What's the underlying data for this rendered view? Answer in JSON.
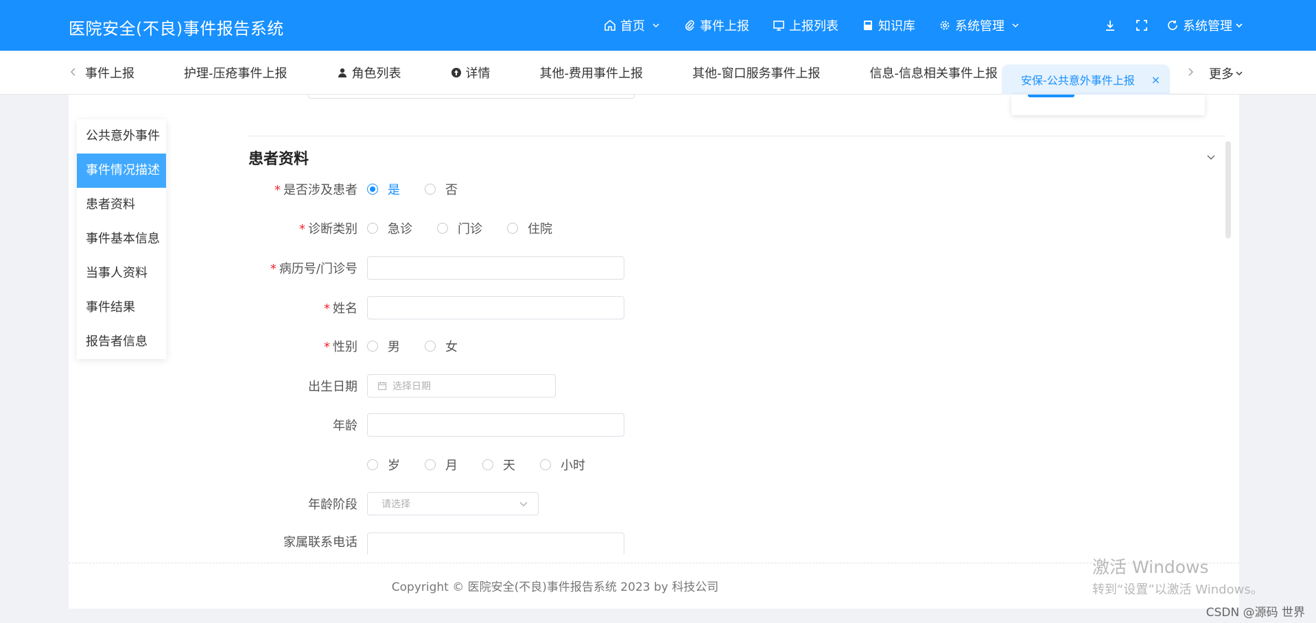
{
  "app": {
    "title": "医院安全(不良)事件报告系统"
  },
  "nav": {
    "items": [
      {
        "label": "首页",
        "icon": "home-icon",
        "dropdown": true
      },
      {
        "label": "事件上报",
        "icon": "paperclip-icon",
        "dropdown": false
      },
      {
        "label": "上报列表",
        "icon": "monitor-icon",
        "dropdown": false
      },
      {
        "label": "知识库",
        "icon": "book-icon",
        "dropdown": false
      },
      {
        "label": "系统管理",
        "icon": "gear-icon",
        "dropdown": true
      }
    ],
    "user_label": "系统管理"
  },
  "tabs": {
    "items": [
      {
        "label": "事件上报",
        "icon": ""
      },
      {
        "label": "护理-压疮事件上报",
        "icon": ""
      },
      {
        "label": "角色列表",
        "icon": "user-icon"
      },
      {
        "label": "详情",
        "icon": "info-circle-icon"
      },
      {
        "label": "其他-费用事件上报",
        "icon": ""
      },
      {
        "label": "其他-窗口服务事件上报",
        "icon": ""
      },
      {
        "label": "信息-信息相关事件上报",
        "icon": ""
      }
    ],
    "active": {
      "label": "安保-公共意外事件上报",
      "close": "×"
    },
    "more_label": "更多"
  },
  "anchor": {
    "items": [
      "公共意外事件",
      "事件情况描述",
      "患者资料",
      "事件基本信息",
      "当事人资料",
      "事件结果",
      "报告者信息"
    ],
    "active_index": 1
  },
  "section": {
    "title": "患者资料",
    "involves_patient": {
      "label": "是否涉及患者",
      "required": "*",
      "options": [
        "是",
        "否"
      ],
      "selected": "是"
    },
    "diagnosis": {
      "label": "诊断类别",
      "required": "*",
      "options": [
        "急诊",
        "门诊",
        "住院"
      ]
    },
    "record_no": {
      "label": "病历号/门诊号",
      "required": "*",
      "value": ""
    },
    "name": {
      "label": "姓名",
      "required": "*",
      "value": ""
    },
    "gender": {
      "label": "性别",
      "required": "*",
      "options": [
        "男",
        "女"
      ]
    },
    "birth_date": {
      "label": "出生日期",
      "placeholder": "选择日期"
    },
    "age": {
      "label": "年龄",
      "value": "",
      "units": [
        "岁",
        "月",
        "天",
        "小时"
      ]
    },
    "age_stage": {
      "label": "年龄阶段",
      "placeholder": "请选择"
    },
    "family_phone": {
      "label": "家属联系电话",
      "value": ""
    }
  },
  "footer": {
    "copyright": "Copyright ©  医院安全(不良)事件报告系统 2023 by 科技公司"
  },
  "watermark": {
    "line1": "激活 Windows",
    "line2": "转到“设置”以激活 Windows。"
  },
  "csdn": "CSDN @源码 世界",
  "colors": {
    "primary": "#1890ff",
    "active_anchor": "#40a9ff",
    "required": "#f5222d"
  }
}
